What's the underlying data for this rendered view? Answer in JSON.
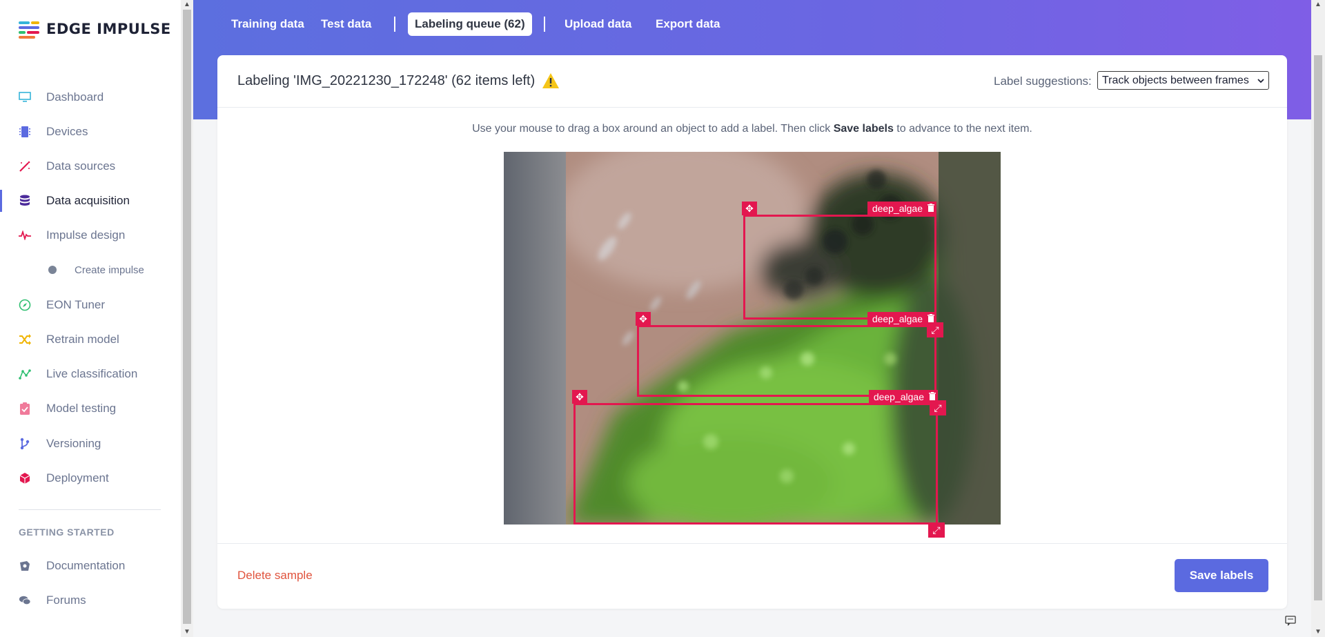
{
  "brand": {
    "name": "EDGE IMPULSE"
  },
  "sidebar": {
    "items": [
      {
        "label": "Dashboard",
        "icon": "monitor-icon",
        "color": "#35b4d9"
      },
      {
        "label": "Devices",
        "icon": "cpu-icon",
        "color": "#5b6ae0"
      },
      {
        "label": "Data sources",
        "icon": "magic-wand-icon",
        "color": "#e3174f"
      },
      {
        "label": "Data acquisition",
        "icon": "database-icon",
        "color": "#4b2a9a",
        "active": true
      },
      {
        "label": "Impulse design",
        "icon": "pulse-icon",
        "color": "#e3174f"
      },
      {
        "label": "Create impulse",
        "icon": "dot-icon",
        "sub": true
      },
      {
        "label": "EON Tuner",
        "icon": "compass-icon",
        "color": "#2fbf71"
      },
      {
        "label": "Retrain model",
        "icon": "shuffle-icon",
        "color": "#f0b400"
      },
      {
        "label": "Live classification",
        "icon": "graph-icon",
        "color": "#2fbf71"
      },
      {
        "label": "Model testing",
        "icon": "clipboard-check-icon",
        "color": "#f07a9a"
      },
      {
        "label": "Versioning",
        "icon": "branch-icon",
        "color": "#5b6ae0"
      },
      {
        "label": "Deployment",
        "icon": "cube-icon",
        "color": "#e3174f"
      }
    ],
    "section_heading": "GETTING STARTED",
    "help_items": [
      {
        "label": "Documentation",
        "icon": "book-icon"
      },
      {
        "label": "Forums",
        "icon": "chat-bubbles-icon"
      }
    ]
  },
  "tabs": {
    "training": "Training data",
    "test": "Test data",
    "queue": "Labeling queue (62)",
    "upload": "Upload data",
    "export": "Export data"
  },
  "labeling": {
    "title": "Labeling 'IMG_20221230_172248' (62 items left)",
    "suggestions_label": "Label suggestions:",
    "suggestions_value": "Track objects between frames",
    "instruction_prefix": "Use your mouse to drag a box around an object to add a label. Then click ",
    "instruction_bold": "Save labels",
    "instruction_suffix": " to advance to the next item.",
    "boxes": [
      {
        "label": "deep_algae"
      },
      {
        "label": "deep_algae"
      },
      {
        "label": "deep_algae"
      }
    ],
    "delete_label": "Delete sample",
    "save_label": "Save labels"
  },
  "colors": {
    "accent": "#5b6ae0",
    "box": "#e3174f",
    "danger": "#e0533d"
  }
}
